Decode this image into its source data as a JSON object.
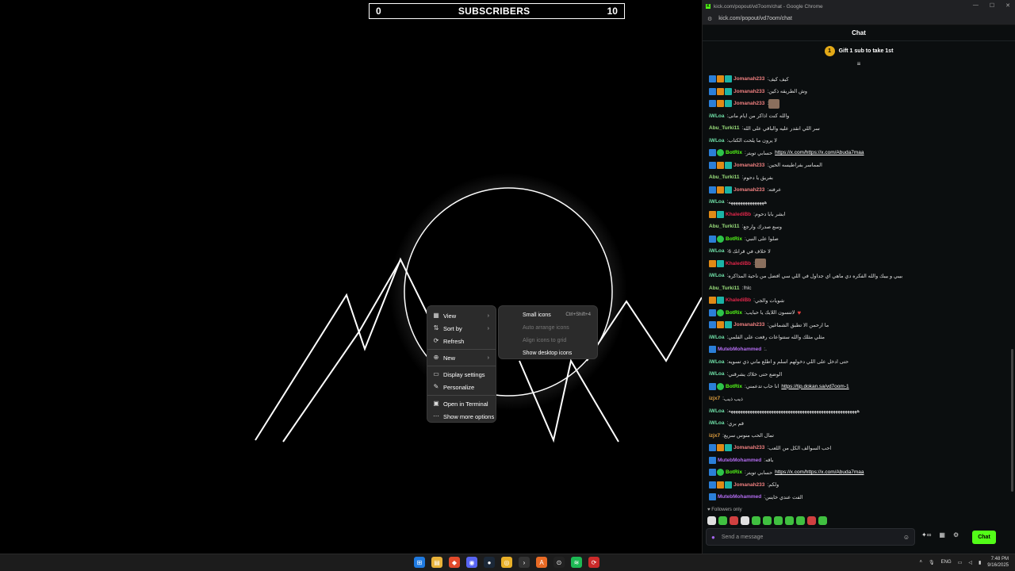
{
  "overlay": {
    "left_count": "0",
    "title": "SUBSCRIBERS",
    "right_count": "10"
  },
  "context_menu": {
    "items": [
      {
        "label": "View",
        "icon": "grid-icon",
        "has_submenu": true
      },
      {
        "label": "Sort by",
        "icon": "sort-icon",
        "has_submenu": true
      },
      {
        "label": "Refresh",
        "icon": "refresh-icon",
        "has_submenu": false
      },
      {
        "label": "New",
        "icon": "plus-icon",
        "has_submenu": true
      },
      {
        "label": "Display settings",
        "icon": "display-icon",
        "has_submenu": false
      },
      {
        "label": "Personalize",
        "icon": "brush-icon",
        "has_submenu": false
      },
      {
        "label": "Open in Terminal",
        "icon": "terminal-icon",
        "has_submenu": false
      },
      {
        "label": "Show more options",
        "icon": "more-icon",
        "has_submenu": false
      }
    ],
    "submenu": [
      {
        "label": "Small icons",
        "shortcut": "Ctrl+Shift+4",
        "disabled": false
      },
      {
        "label": "Auto arrange icons",
        "shortcut": "",
        "disabled": true
      },
      {
        "label": "Align icons to grid",
        "shortcut": "",
        "disabled": true
      },
      {
        "label": "Show desktop icons",
        "shortcut": "",
        "disabled": false
      }
    ]
  },
  "browser": {
    "window_title": "kick.com/popout/vd7oom/chat - Google Chrome",
    "url": "kick.com/popout/vd7oom/chat",
    "chat_title": "Chat",
    "gift_rank": "1",
    "gift_text": "Gift 1 sub to take 1st",
    "followers_only": "Followers only",
    "input_placeholder": "Send a message",
    "send_label": "Chat"
  },
  "messages": [
    {
      "user": "Jomanah233",
      "color": "#f08080",
      "badges": [
        "b-mod",
        "b-vip",
        "b-sub"
      ],
      "text": "كيف كيف"
    },
    {
      "user": "Jomanah233",
      "color": "#f08080",
      "badges": [
        "b-mod",
        "b-vip",
        "b-sub"
      ],
      "text": "وش الطريقه ذكين"
    },
    {
      "user": "Jomanah233",
      "color": "#f08080",
      "badges": [
        "b-mod",
        "b-vip",
        "b-sub"
      ],
      "text": "",
      "emote": true
    },
    {
      "user": "iWLoa",
      "color": "#6fe0a8",
      "badges": [],
      "text": "والله كنت اذاكر من ايام مانى"
    },
    {
      "user": "Abu_Turki11",
      "color": "#9be07c",
      "badges": [],
      "text": "سر اللي انقدر عليه والباقي على الله"
    },
    {
      "user": "iWLoa",
      "color": "#6fe0a8",
      "badges": [],
      "text": "لا يرون ما يلحت الكتاب"
    },
    {
      "user": "BotRix",
      "color": "#53fc18",
      "badges": [
        "b-bot",
        "b-verified"
      ],
      "text": "حسابي تويتر",
      "link": "https://x.com/https://x.com/Abuda7maa"
    },
    {
      "user": "Jomanah233",
      "color": "#f08080",
      "badges": [
        "b-mod",
        "b-vip",
        "b-sub"
      ],
      "text": "المماسر بفراطيسه الحين"
    },
    {
      "user": "Abu_Turki11",
      "color": "#9be07c",
      "badges": [],
      "text": "بفريق يا دحوم"
    },
    {
      "user": "Jomanah233",
      "color": "#f08080",
      "badges": [
        "b-mod",
        "b-vip",
        "b-sub"
      ],
      "text": "عرفته"
    },
    {
      "user": "iWLoa",
      "color": "#6fe0a8",
      "badges": [],
      "text": "هههههههههههههههه"
    },
    {
      "user": "KhalediBb",
      "color": "#e0264a",
      "badges": [
        "b-crown",
        "b-sub"
      ],
      "text": "ابشر بابا دحوم"
    },
    {
      "user": "Abu_Turki11",
      "color": "#9be07c",
      "badges": [],
      "text": "وسع صدرك وارجع"
    },
    {
      "user": "BotRix",
      "color": "#53fc18",
      "badges": [
        "b-bot",
        "b-verified"
      ],
      "text": "صلوا على النبي"
    },
    {
      "user": "iWLoa",
      "color": "#6fe0a8",
      "badges": [],
      "text": "6 لا خلاف في قرانك"
    },
    {
      "user": "KhalediBb",
      "color": "#e0264a",
      "badges": [
        "b-crown",
        "b-sub"
      ],
      "text": "",
      "emote": true
    },
    {
      "user": "iWLoa",
      "color": "#6fe0a8",
      "badges": [],
      "text": "بيبي و بيبك والله الفكره دي ماهي اي جداول في اللي سي افضل من ناحية المذاكره"
    },
    {
      "user": "Abu_Turki11",
      "color": "#9be07c",
      "badges": [],
      "text": "!hlc"
    },
    {
      "user": "KhalediBb",
      "color": "#e0264a",
      "badges": [
        "b-crown",
        "b-sub"
      ],
      "text": "شويات والجي"
    },
    {
      "user": "BotRix",
      "color": "#53fc18",
      "badges": [
        "b-bot",
        "b-verified"
      ],
      "text": "لاتنسون اللايك يا حبايب",
      "heart": true
    },
    {
      "user": "Jomanah233",
      "color": "#f08080",
      "badges": [
        "b-mod",
        "b-vip",
        "b-sub"
      ],
      "text": "ما ارحمن الا تطبق الشماغين"
    },
    {
      "user": "iWLoa",
      "color": "#6fe0a8",
      "badges": [],
      "text": "مثلي مثلك والله ستنواعات رفعت على القلمي"
    },
    {
      "user": "MutebMohammed",
      "color": "#b36cf0",
      "badges": [
        "b-mod"
      ],
      "text": "."
    },
    {
      "user": "iWLoa",
      "color": "#6fe0a8",
      "badges": [],
      "text": "حتى ادخل على اللي دخولهم اسلم و اطلع ماني ذي تسويه"
    },
    {
      "user": "iWLoa",
      "color": "#6fe0a8",
      "badges": [],
      "text": "الوضع حتى خلاك يشرقني"
    },
    {
      "user": "BotRix",
      "color": "#53fc18",
      "badges": [
        "b-bot",
        "b-verified"
      ],
      "text": "انا حاب تدعمني",
      "link": "https://tip.dokan.sa/vd7oom-1"
    },
    {
      "user": "izjx7",
      "color": "#e0a040",
      "badges": [],
      "text": "ذيب ذيب"
    },
    {
      "user": "iWLoa",
      "color": "#6fe0a8",
      "badges": [],
      "text": "ههههههههههههههههههههههههههههههههههههههههههههههههههههههه"
    },
    {
      "user": "iWLoa",
      "color": "#6fe0a8",
      "badges": [],
      "text": "قم بري"
    },
    {
      "user": "izjx7",
      "color": "#e0a040",
      "badges": [],
      "text": "تمال الحب منوس سريع"
    },
    {
      "user": "Jomanah233",
      "color": "#f08080",
      "badges": [
        "b-mod",
        "b-vip",
        "b-sub"
      ],
      "text": "احب السوالف الكل من اللعب"
    },
    {
      "user": "MutebMohammed",
      "color": "#b36cf0",
      "badges": [
        "b-mod"
      ],
      "text": "باقه"
    },
    {
      "user": "BotRix",
      "color": "#53fc18",
      "badges": [
        "b-bot",
        "b-verified"
      ],
      "text": "حسابي تويتر",
      "link": "https://x.com/https://x.com/Abuda7maa"
    },
    {
      "user": "Jomanah233",
      "color": "#f08080",
      "badges": [
        "b-mod",
        "b-vip",
        "b-sub"
      ],
      "text": "ولكم"
    },
    {
      "user": "MutebMohammed",
      "color": "#b36cf0",
      "badges": [
        "b-mod"
      ],
      "text": "الفت عندي خايس"
    }
  ],
  "emote_colors": [
    "#e0e0e0",
    "#40c040",
    "#d04040",
    "#e0e0e0",
    "#40c040",
    "#40c040",
    "#40c040",
    "#40c040",
    "#40c040",
    "#d04040",
    "#40c040"
  ],
  "taskbar": {
    "language": "ENG",
    "time": "7:48 PM",
    "date": "9/16/2025"
  }
}
